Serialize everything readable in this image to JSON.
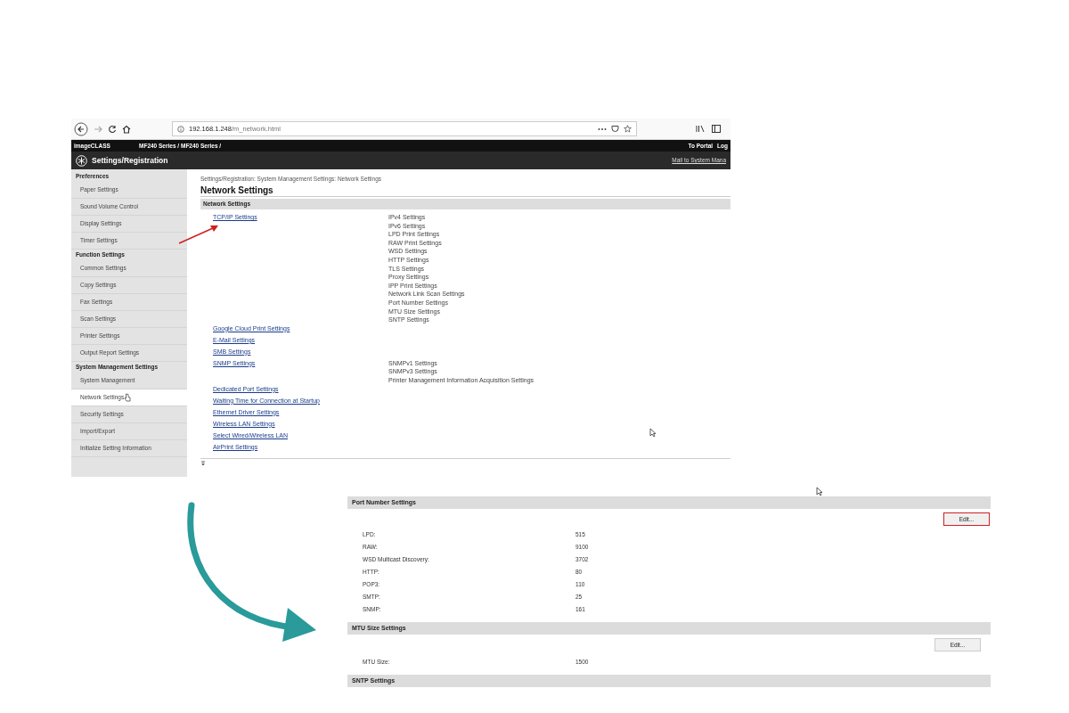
{
  "browser": {
    "url_host": "192.168.1.248",
    "url_path": "/m_network.html"
  },
  "header": {
    "brand": "imageCLASS",
    "model": "MF240 Series / MF240 Series /",
    "links": [
      "To Portal",
      "Log"
    ],
    "title": "Settings/Registration",
    "mail_link": "Mail to System Mana"
  },
  "sidebar": {
    "groups": [
      {
        "title": "Preferences",
        "items": [
          {
            "label": "Paper Settings",
            "selected": false
          },
          {
            "label": "Sound Volume Control",
            "selected": false
          },
          {
            "label": "Display Settings",
            "selected": false
          },
          {
            "label": "Timer Settings",
            "selected": false
          }
        ]
      },
      {
        "title": "Function Settings",
        "items": [
          {
            "label": "Common Settings",
            "selected": false
          },
          {
            "label": "Copy Settings",
            "selected": false
          },
          {
            "label": "Fax Settings",
            "selected": false
          },
          {
            "label": "Scan Settings",
            "selected": false
          },
          {
            "label": "Printer Settings",
            "selected": false
          },
          {
            "label": "Output Report Settings",
            "selected": false
          }
        ]
      },
      {
        "title": "System Management Settings",
        "items": [
          {
            "label": "System Management",
            "selected": false
          },
          {
            "label": "Network Settings",
            "selected": true
          },
          {
            "label": "Security Settings",
            "selected": false
          },
          {
            "label": "Import/Export",
            "selected": false
          },
          {
            "label": "Initialize Setting Information",
            "selected": false
          }
        ]
      }
    ]
  },
  "content": {
    "breadcrumb": "Settings/Registration: System Management Settings: Network Settings",
    "title": "Network Settings",
    "section": "Network Settings",
    "links": [
      {
        "label": "TCP/IP Settings",
        "sub_items": [
          "IPv4 Settings",
          "IPv6 Settings",
          "LPD Print Settings",
          "RAW Print Settings",
          "WSD Settings",
          "HTTP Settings",
          "TLS Settings",
          "Proxy Settings",
          "IPP Print Settings",
          "Network Link Scan Settings",
          "Port Number Settings",
          "MTU Size Settings",
          "SNTP Settings"
        ]
      },
      {
        "label": "Google Cloud Print Settings"
      },
      {
        "label": "E-Mail Settings"
      },
      {
        "label": "SMB Settings"
      },
      {
        "label": "SNMP Settings",
        "sub_items": [
          "SNMPv1 Settings",
          "SNMPv3 Settings",
          "Printer Management Information Acquisition Settings"
        ]
      },
      {
        "label": "Dedicated Port Settings"
      },
      {
        "label": "Waiting Time for Connection at Startup"
      },
      {
        "label": "Ethernet Driver Settings"
      },
      {
        "label": "Wireless LAN Settings"
      },
      {
        "label": "Select Wired/Wireless LAN"
      },
      {
        "label": "AirPrint Settings"
      }
    ]
  },
  "detail": {
    "sections": [
      {
        "title": "Port Number Settings",
        "button": "Edit...",
        "highlighted": true,
        "rows": [
          {
            "label": "LPD:",
            "value": "515"
          },
          {
            "label": "RAW:",
            "value": "9100"
          },
          {
            "label": "WSD Multicast Discovery:",
            "value": "3702"
          },
          {
            "label": "HTTP:",
            "value": "80"
          },
          {
            "label": "POP3:",
            "value": "110"
          },
          {
            "label": "SMTP:",
            "value": "25"
          },
          {
            "label": "SNMP:",
            "value": "161"
          }
        ]
      },
      {
        "title": "MTU Size Settings",
        "button": "Edit...",
        "highlighted": false,
        "rows": [
          {
            "label": "MTU Size:",
            "value": "1500"
          }
        ]
      },
      {
        "title": "SNTP Settings"
      }
    ]
  }
}
